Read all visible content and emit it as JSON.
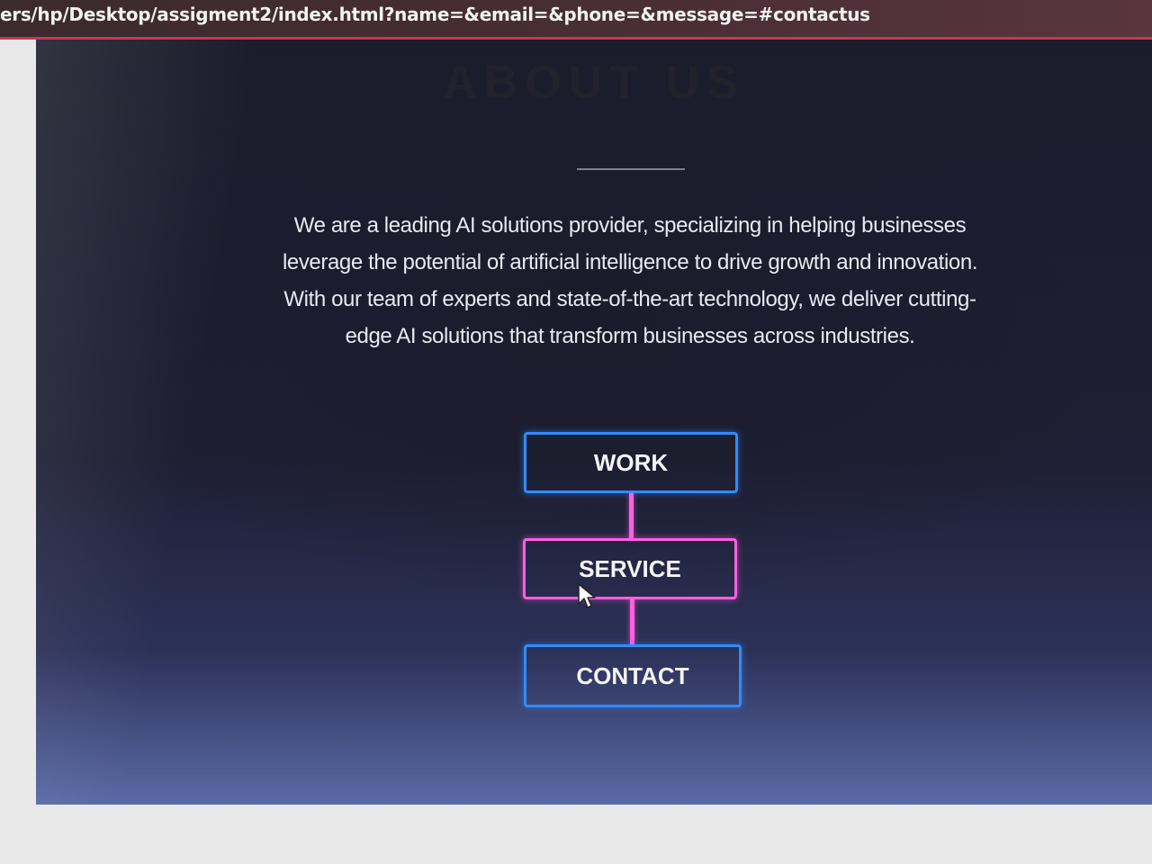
{
  "browser": {
    "address": "ers/hp/Desktop/assigment2/index.html?name=&email=&phone=&message=#contactus"
  },
  "about": {
    "title": "ABOUT US",
    "description": "We are a leading AI solutions provider, specializing in helping businesses leverage the potential of artificial intelligence to drive growth and innovation. With our team of experts and state-of-the-art technology, we deliver cutting-edge AI solutions that transform businesses across industries."
  },
  "nav": {
    "items": [
      {
        "label": "WORK",
        "color": "#2f8cff"
      },
      {
        "label": "SERVICE",
        "color": "#ff5fe0"
      },
      {
        "label": "CONTACT",
        "color": "#2f8cff"
      }
    ],
    "connector_color": "#ff5fe0"
  },
  "cursor": {
    "icon": "mouse-pointer-icon"
  }
}
